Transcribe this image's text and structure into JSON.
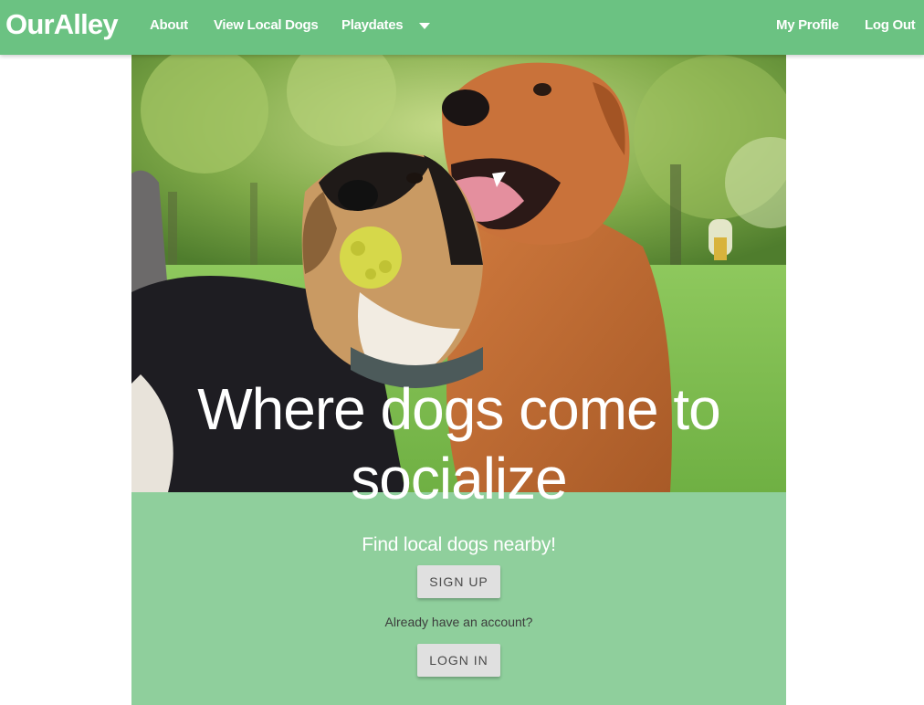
{
  "navbar": {
    "brand": "OurAlley",
    "links": {
      "about": "About",
      "view_local_dogs": "View Local Dogs",
      "playdates": "Playdates",
      "my_profile": "My Profile",
      "log_out": "Log Out"
    },
    "background_color": "#6bc282"
  },
  "hero": {
    "headline": "Where dogs come to socialize",
    "image_description_icon": "dogs-photo"
  },
  "cta": {
    "subtitle": "Find local dogs nearby!",
    "signup_label": "SIGN UP",
    "already_text": "Already have an account?",
    "login_label": "LOGN IN",
    "panel_color": "#8fcf9c"
  }
}
